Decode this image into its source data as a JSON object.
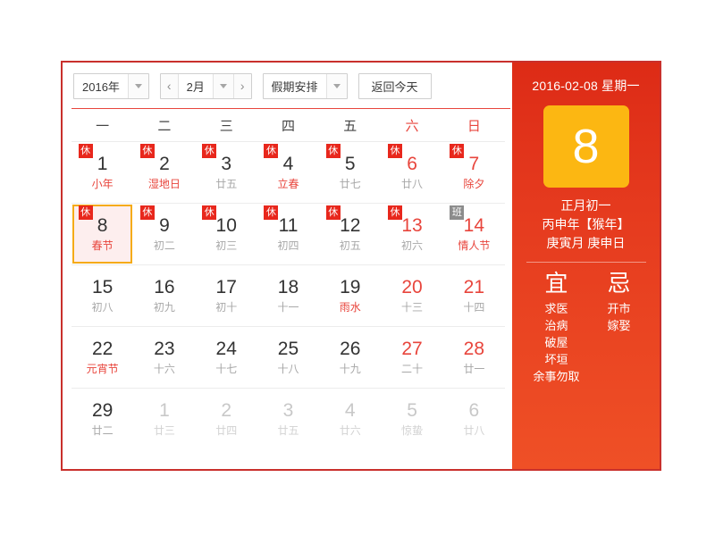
{
  "toolbar": {
    "year_value": "2016年",
    "month_value": "2月",
    "prev_icon": "‹",
    "next_icon": "›",
    "holiday_value": "假期安排",
    "today_label": "返回今天"
  },
  "weekdays": [
    {
      "label": "一",
      "weekend": false
    },
    {
      "label": "二",
      "weekend": false
    },
    {
      "label": "三",
      "weekend": false
    },
    {
      "label": "四",
      "weekend": false
    },
    {
      "label": "五",
      "weekend": false
    },
    {
      "label": "六",
      "weekend": true
    },
    {
      "label": "日",
      "weekend": true
    }
  ],
  "weeks": [
    [
      {
        "num": "1",
        "sub": "小年",
        "badge": "休",
        "badge_type": "rest",
        "red": false,
        "redsub": true,
        "dim": false,
        "selected": false
      },
      {
        "num": "2",
        "sub": "湿地日",
        "badge": "休",
        "badge_type": "rest",
        "red": false,
        "redsub": true,
        "dim": false,
        "selected": false
      },
      {
        "num": "3",
        "sub": "廿五",
        "badge": "休",
        "badge_type": "rest",
        "red": false,
        "redsub": false,
        "dim": false,
        "selected": false
      },
      {
        "num": "4",
        "sub": "立春",
        "badge": "休",
        "badge_type": "rest",
        "red": false,
        "redsub": true,
        "dim": false,
        "selected": false
      },
      {
        "num": "5",
        "sub": "廿七",
        "badge": "休",
        "badge_type": "rest",
        "red": false,
        "redsub": false,
        "dim": false,
        "selected": false
      },
      {
        "num": "6",
        "sub": "廿八",
        "badge": "休",
        "badge_type": "rest",
        "red": true,
        "redsub": false,
        "dim": false,
        "selected": false
      },
      {
        "num": "7",
        "sub": "除夕",
        "badge": "休",
        "badge_type": "rest",
        "red": true,
        "redsub": true,
        "dim": false,
        "selected": false
      }
    ],
    [
      {
        "num": "8",
        "sub": "春节",
        "badge": "休",
        "badge_type": "rest",
        "red": false,
        "redsub": true,
        "dim": false,
        "selected": true
      },
      {
        "num": "9",
        "sub": "初二",
        "badge": "休",
        "badge_type": "rest",
        "red": false,
        "redsub": false,
        "dim": false,
        "selected": false
      },
      {
        "num": "10",
        "sub": "初三",
        "badge": "休",
        "badge_type": "rest",
        "red": false,
        "redsub": false,
        "dim": false,
        "selected": false
      },
      {
        "num": "11",
        "sub": "初四",
        "badge": "休",
        "badge_type": "rest",
        "red": false,
        "redsub": false,
        "dim": false,
        "selected": false
      },
      {
        "num": "12",
        "sub": "初五",
        "badge": "休",
        "badge_type": "rest",
        "red": false,
        "redsub": false,
        "dim": false,
        "selected": false
      },
      {
        "num": "13",
        "sub": "初六",
        "badge": "休",
        "badge_type": "rest",
        "red": true,
        "redsub": false,
        "dim": false,
        "selected": false
      },
      {
        "num": "14",
        "sub": "情人节",
        "badge": "班",
        "badge_type": "work",
        "red": true,
        "redsub": true,
        "dim": false,
        "selected": false
      }
    ],
    [
      {
        "num": "15",
        "sub": "初八",
        "badge": "",
        "badge_type": "",
        "red": false,
        "redsub": false,
        "dim": false,
        "selected": false
      },
      {
        "num": "16",
        "sub": "初九",
        "badge": "",
        "badge_type": "",
        "red": false,
        "redsub": false,
        "dim": false,
        "selected": false
      },
      {
        "num": "17",
        "sub": "初十",
        "badge": "",
        "badge_type": "",
        "red": false,
        "redsub": false,
        "dim": false,
        "selected": false
      },
      {
        "num": "18",
        "sub": "十一",
        "badge": "",
        "badge_type": "",
        "red": false,
        "redsub": false,
        "dim": false,
        "selected": false
      },
      {
        "num": "19",
        "sub": "雨水",
        "badge": "",
        "badge_type": "",
        "red": false,
        "redsub": true,
        "dim": false,
        "selected": false
      },
      {
        "num": "20",
        "sub": "十三",
        "badge": "",
        "badge_type": "",
        "red": true,
        "redsub": false,
        "dim": false,
        "selected": false
      },
      {
        "num": "21",
        "sub": "十四",
        "badge": "",
        "badge_type": "",
        "red": true,
        "redsub": false,
        "dim": false,
        "selected": false
      }
    ],
    [
      {
        "num": "22",
        "sub": "元宵节",
        "badge": "",
        "badge_type": "",
        "red": false,
        "redsub": true,
        "dim": false,
        "selected": false
      },
      {
        "num": "23",
        "sub": "十六",
        "badge": "",
        "badge_type": "",
        "red": false,
        "redsub": false,
        "dim": false,
        "selected": false
      },
      {
        "num": "24",
        "sub": "十七",
        "badge": "",
        "badge_type": "",
        "red": false,
        "redsub": false,
        "dim": false,
        "selected": false
      },
      {
        "num": "25",
        "sub": "十八",
        "badge": "",
        "badge_type": "",
        "red": false,
        "redsub": false,
        "dim": false,
        "selected": false
      },
      {
        "num": "26",
        "sub": "十九",
        "badge": "",
        "badge_type": "",
        "red": false,
        "redsub": false,
        "dim": false,
        "selected": false
      },
      {
        "num": "27",
        "sub": "二十",
        "badge": "",
        "badge_type": "",
        "red": true,
        "redsub": false,
        "dim": false,
        "selected": false
      },
      {
        "num": "28",
        "sub": "廿一",
        "badge": "",
        "badge_type": "",
        "red": true,
        "redsub": false,
        "dim": false,
        "selected": false
      }
    ],
    [
      {
        "num": "29",
        "sub": "廿二",
        "badge": "",
        "badge_type": "",
        "red": false,
        "redsub": false,
        "dim": false,
        "selected": false
      },
      {
        "num": "1",
        "sub": "廿三",
        "badge": "",
        "badge_type": "",
        "red": false,
        "redsub": false,
        "dim": true,
        "selected": false
      },
      {
        "num": "2",
        "sub": "廿四",
        "badge": "",
        "badge_type": "",
        "red": false,
        "redsub": false,
        "dim": true,
        "selected": false
      },
      {
        "num": "3",
        "sub": "廿五",
        "badge": "",
        "badge_type": "",
        "red": false,
        "redsub": false,
        "dim": true,
        "selected": false
      },
      {
        "num": "4",
        "sub": "廿六",
        "badge": "",
        "badge_type": "",
        "red": false,
        "redsub": false,
        "dim": true,
        "selected": false
      },
      {
        "num": "5",
        "sub": "惊蛰",
        "badge": "",
        "badge_type": "",
        "red": false,
        "redsub": false,
        "dim": true,
        "selected": false
      },
      {
        "num": "6",
        "sub": "廿八",
        "badge": "",
        "badge_type": "",
        "red": false,
        "redsub": false,
        "dim": true,
        "selected": false
      }
    ]
  ],
  "detail": {
    "date_line": "2016-02-08 星期一",
    "day_number": "8",
    "lunar_day": "正月初一",
    "lunar_year": "丙申年【猴年】",
    "ganzhi": "庚寅月 庚申日",
    "good_title": "宜",
    "good_items": [
      "求医",
      "治病",
      "破屋",
      "坏垣",
      "余事勿取"
    ],
    "bad_title": "忌",
    "bad_items": [
      "开市",
      "嫁娶"
    ]
  },
  "colors": {
    "frame_border": "#c9302c",
    "accent_red": "#e8453c",
    "badge_rest": "#e8271c",
    "badge_work": "#8c8c8c",
    "selected_border": "#f5ab18",
    "selected_bg": "#fdeeee",
    "panel_top": "#dd2b16",
    "panel_bottom": "#ef5026",
    "tile_gold": "#fcb712"
  }
}
